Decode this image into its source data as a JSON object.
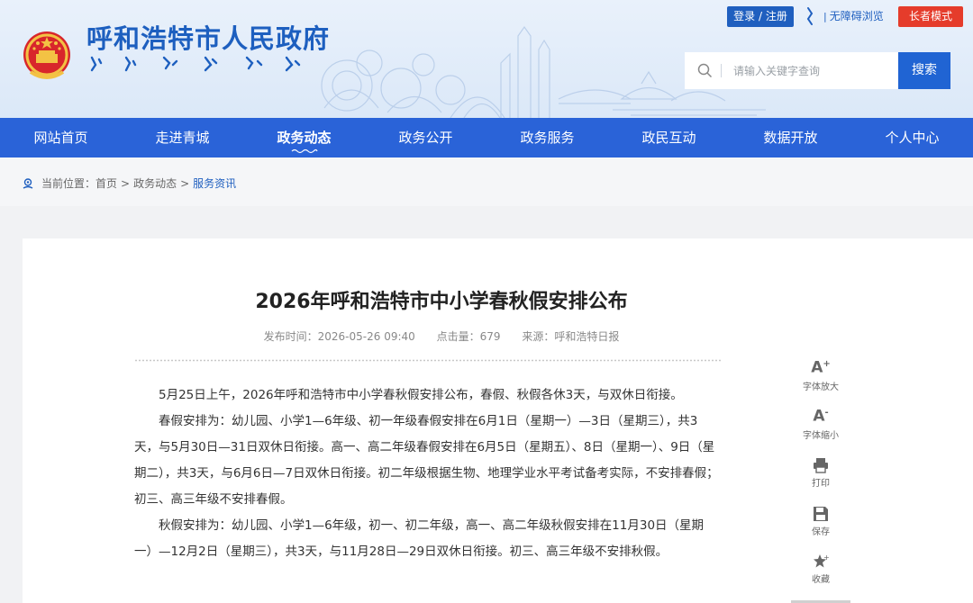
{
  "header": {
    "site_title": "呼和浩特市人民政府",
    "login_label": "登录 / 注册",
    "accessible_label": "无障碍浏览",
    "elder_label": "长者模式",
    "search_placeholder": "请输入关键字查询",
    "search_button": "搜索"
  },
  "nav": {
    "items": [
      {
        "label": "网站首页"
      },
      {
        "label": "走进青城"
      },
      {
        "label": "政务动态"
      },
      {
        "label": "政务公开"
      },
      {
        "label": "政务服务"
      },
      {
        "label": "政民互动"
      },
      {
        "label": "数据开放"
      },
      {
        "label": "个人中心"
      }
    ],
    "active": "政务动态"
  },
  "breadcrumb": {
    "prefix": "当前位置：",
    "home": "首页",
    "sep": ">",
    "section": "政务动态",
    "current": "服务资讯"
  },
  "article": {
    "title": "2026年呼和浩特市中小学春秋假安排公布",
    "publish_time": "发布时间：2026-05-26 09:40",
    "clicks": "点击量：679",
    "source": "来源：呼和浩特日报",
    "paragraphs": [
      "5月25日上午，2026年呼和浩特市中小学春秋假安排公布，春假、秋假各休3天，与双休日衔接。",
      "春假安排为：幼儿园、小学1—6年级、初一年级春假安排在6月1日（星期一）—3日（星期三），共3天，与5月30日—31日双休日衔接。高一、高二年级春假安排在6月5日（星期五）、8日（星期一）、9日（星期二），共3天，与6月6日—7日双休日衔接。初二年级根据生物、地理学业水平考试备考实际，不安排春假；初三、高三年级不安排春假。",
      "秋假安排为：幼儿园、小学1—6年级，初一、初二年级，高一、高二年级秋假安排在11月30日（星期一）—12月2日（星期三），共3天，与11月28日—29日双休日衔接。初三、高三年级不安排秋假。"
    ]
  },
  "tools": {
    "enlarge": "字体放大",
    "shrink": "字体缩小",
    "print": "打印",
    "save": "保存",
    "favorite": "收藏"
  },
  "colors": {
    "brand_blue": "#2a63d8",
    "title_blue": "#1d5fbf",
    "elder_red": "#e53c2b"
  }
}
